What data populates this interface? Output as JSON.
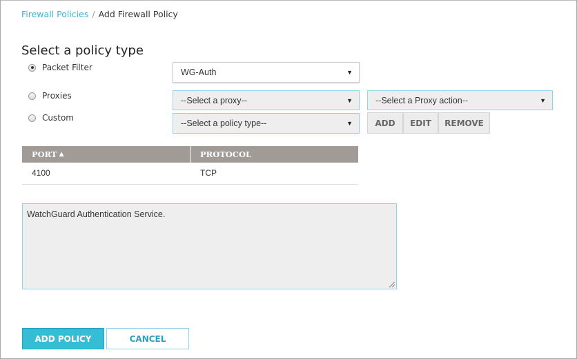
{
  "breadcrumb": {
    "parent": "Firewall Policies",
    "separator": "/",
    "current": "Add Firewall Policy"
  },
  "title": "Select a policy type",
  "policy_types": [
    {
      "label": "Packet Filter",
      "selected": true
    },
    {
      "label": "Proxies",
      "selected": false
    },
    {
      "label": "Custom",
      "selected": false
    }
  ],
  "selects": {
    "packet_filter": "WG-Auth",
    "proxy": "--Select a proxy--",
    "proxy_action": "--Select a Proxy action--",
    "custom": "--Select a policy type--"
  },
  "action_buttons": {
    "add": "ADD",
    "edit": "EDIT",
    "remove": "REMOVE"
  },
  "table": {
    "headers": [
      "PORT",
      "PROTOCOL"
    ],
    "rows": [
      [
        "4100",
        "TCP"
      ]
    ]
  },
  "description": "WatchGuard Authentication Service.",
  "footer": {
    "add_policy": "ADD POLICY",
    "cancel": "CANCEL"
  },
  "colors": {
    "accent": "#35bdd6",
    "header": "#a19b97"
  }
}
